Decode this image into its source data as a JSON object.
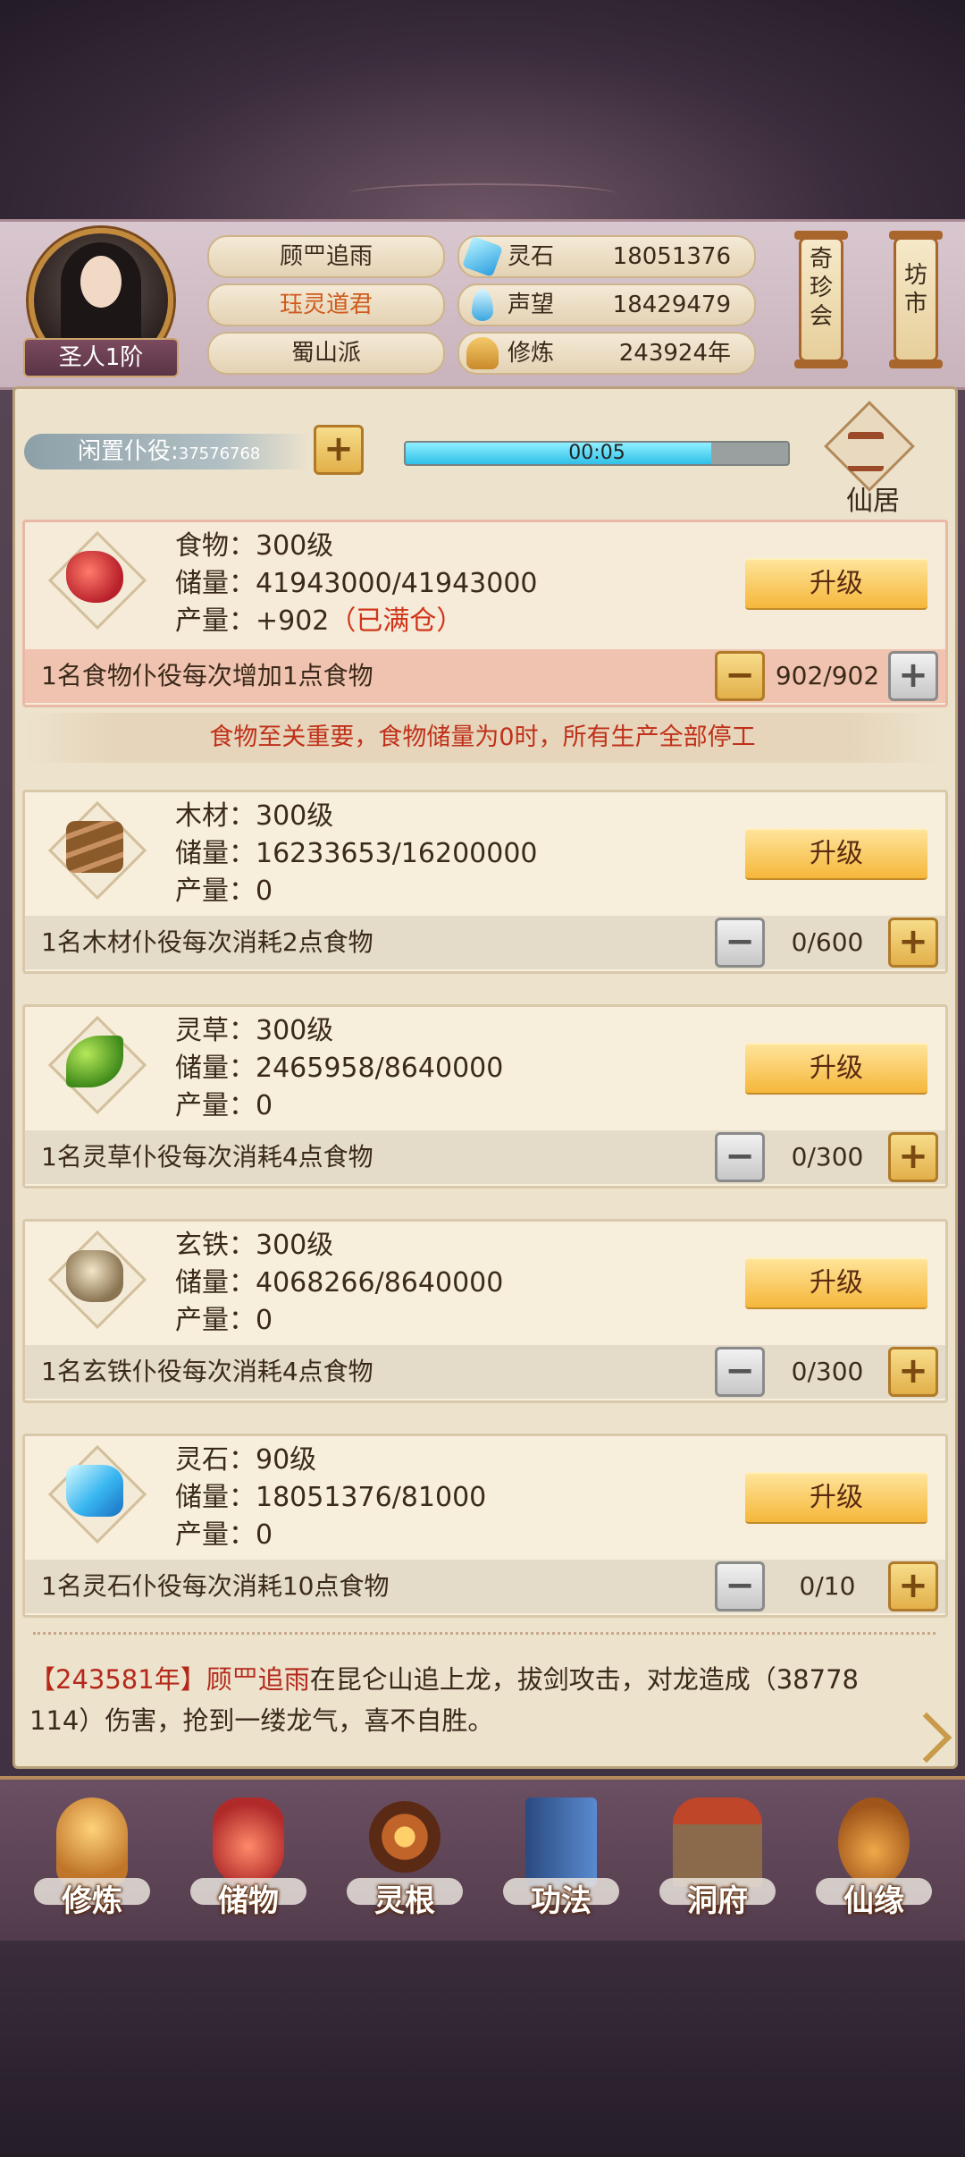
{
  "player": {
    "name": "顾罒追雨",
    "title": "珏灵道君",
    "sect": "蜀山派",
    "rank": "圣人1阶"
  },
  "stats": [
    {
      "label": "灵石",
      "value": "18051376",
      "icon": "spirit-stone-icon"
    },
    {
      "label": "声望",
      "value": "18429479",
      "icon": "reputation-icon"
    },
    {
      "label": "修炼",
      "value": "243924年",
      "icon": "meditation-icon"
    }
  ],
  "side_buttons": {
    "treasure": "奇珍会",
    "market": "坊市"
  },
  "idle": {
    "label": "闲置仆役:",
    "count": "37576768",
    "timer": "00:05",
    "progress": 0.8
  },
  "home_label": "仙居",
  "resources": [
    {
      "line1": "食物：300级",
      "line2": "储量：41943000/41943000",
      "line3": "产量：+902",
      "full": "（已满仓）",
      "upgrade": "升级",
      "worker_text": "1名食物仆役每次增加1点食物",
      "worker_count": "902/902",
      "minus": "−",
      "plus": "+"
    },
    {
      "line1": "木材：300级",
      "line2": "储量：16233653/16200000",
      "line3": "产量：0",
      "upgrade": "升级",
      "worker_text": "1名木材仆役每次消耗2点食物",
      "worker_count": "0/600",
      "minus": "−",
      "plus": "+"
    },
    {
      "line1": "灵草：300级",
      "line2": "储量：2465958/8640000",
      "line3": "产量：0",
      "upgrade": "升级",
      "worker_text": "1名灵草仆役每次消耗4点食物",
      "worker_count": "0/300",
      "minus": "−",
      "plus": "+"
    },
    {
      "line1": "玄铁：300级",
      "line2": "储量：4068266/8640000",
      "line3": "产量：0",
      "upgrade": "升级",
      "worker_text": "1名玄铁仆役每次消耗4点食物",
      "worker_count": "0/300",
      "minus": "−",
      "plus": "+"
    },
    {
      "line1": "灵石：90级",
      "line2": "储量：18051376/81000",
      "line3": "产量：0",
      "upgrade": "升级",
      "worker_text": "1名灵石仆役每次消耗10点食物",
      "worker_count": "0/10",
      "minus": "−",
      "plus": "+"
    }
  ],
  "warning": "食物至关重要，食物储量为0时，所有生产全部停工",
  "log": {
    "year": "【243581年】",
    "name": "顾罒追雨",
    "text1": "在昆仑山追上龙，拔剑攻击，对龙造成（38778",
    "text2": "114）伤害，抢到一缕龙气，喜不自胜。"
  },
  "nav": [
    {
      "label": "修炼",
      "icon": "cultivate-icon",
      "color": "#e0a43a"
    },
    {
      "label": "储物",
      "icon": "storage-bag-icon",
      "color": "#d0463a"
    },
    {
      "label": "灵根",
      "icon": "spirit-root-icon",
      "color": "#c9762a"
    },
    {
      "label": "功法",
      "icon": "skill-book-icon",
      "color": "#3a6aa8"
    },
    {
      "label": "洞府",
      "icon": "cave-dwelling-icon",
      "color": "#7a5a3a"
    },
    {
      "label": "仙缘",
      "icon": "gourd-icon",
      "color": "#c8803a"
    }
  ],
  "colors": {
    "accent": "#f5b73a",
    "warning": "#c0301a",
    "progress": "#2fc0e8"
  }
}
